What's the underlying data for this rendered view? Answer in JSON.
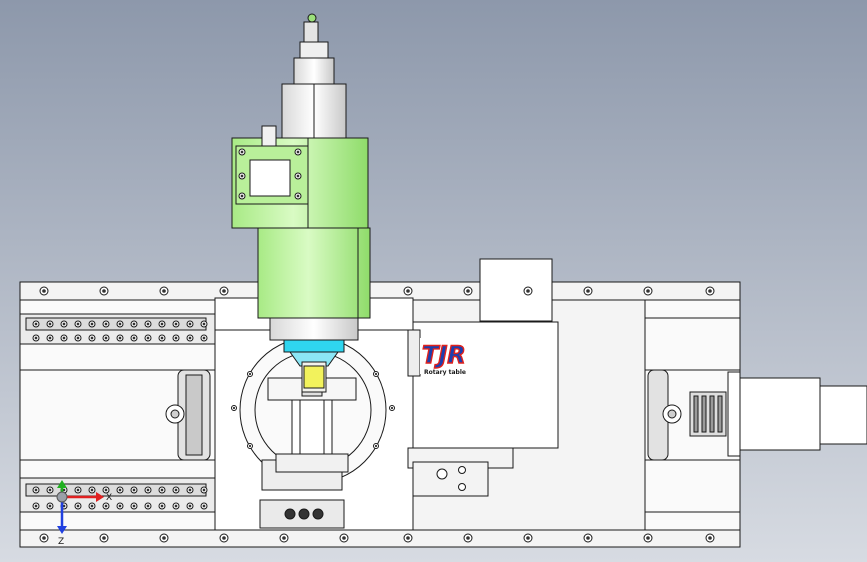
{
  "viewport": {
    "background_top": "#8d98ab",
    "background_bottom": "#d7dbe2"
  },
  "model": {
    "colors": {
      "outline": "#1a1a1a",
      "body": "#ffffff",
      "spindle_green": "#bff3a0",
      "spindle_green_dark": "#7fd45a",
      "collet_cyan": "#2fd6f0",
      "tool_yellow": "#f2f25c",
      "logo_red": "#e0211c",
      "logo_blue": "#1c3fae"
    },
    "logo": {
      "main": "TJR",
      "sub": "Rotary table"
    }
  },
  "triad": {
    "x_label": "X",
    "z_label": "Z",
    "x_color": "#e02020",
    "y_color": "#20b020",
    "z_color": "#2040e0"
  }
}
